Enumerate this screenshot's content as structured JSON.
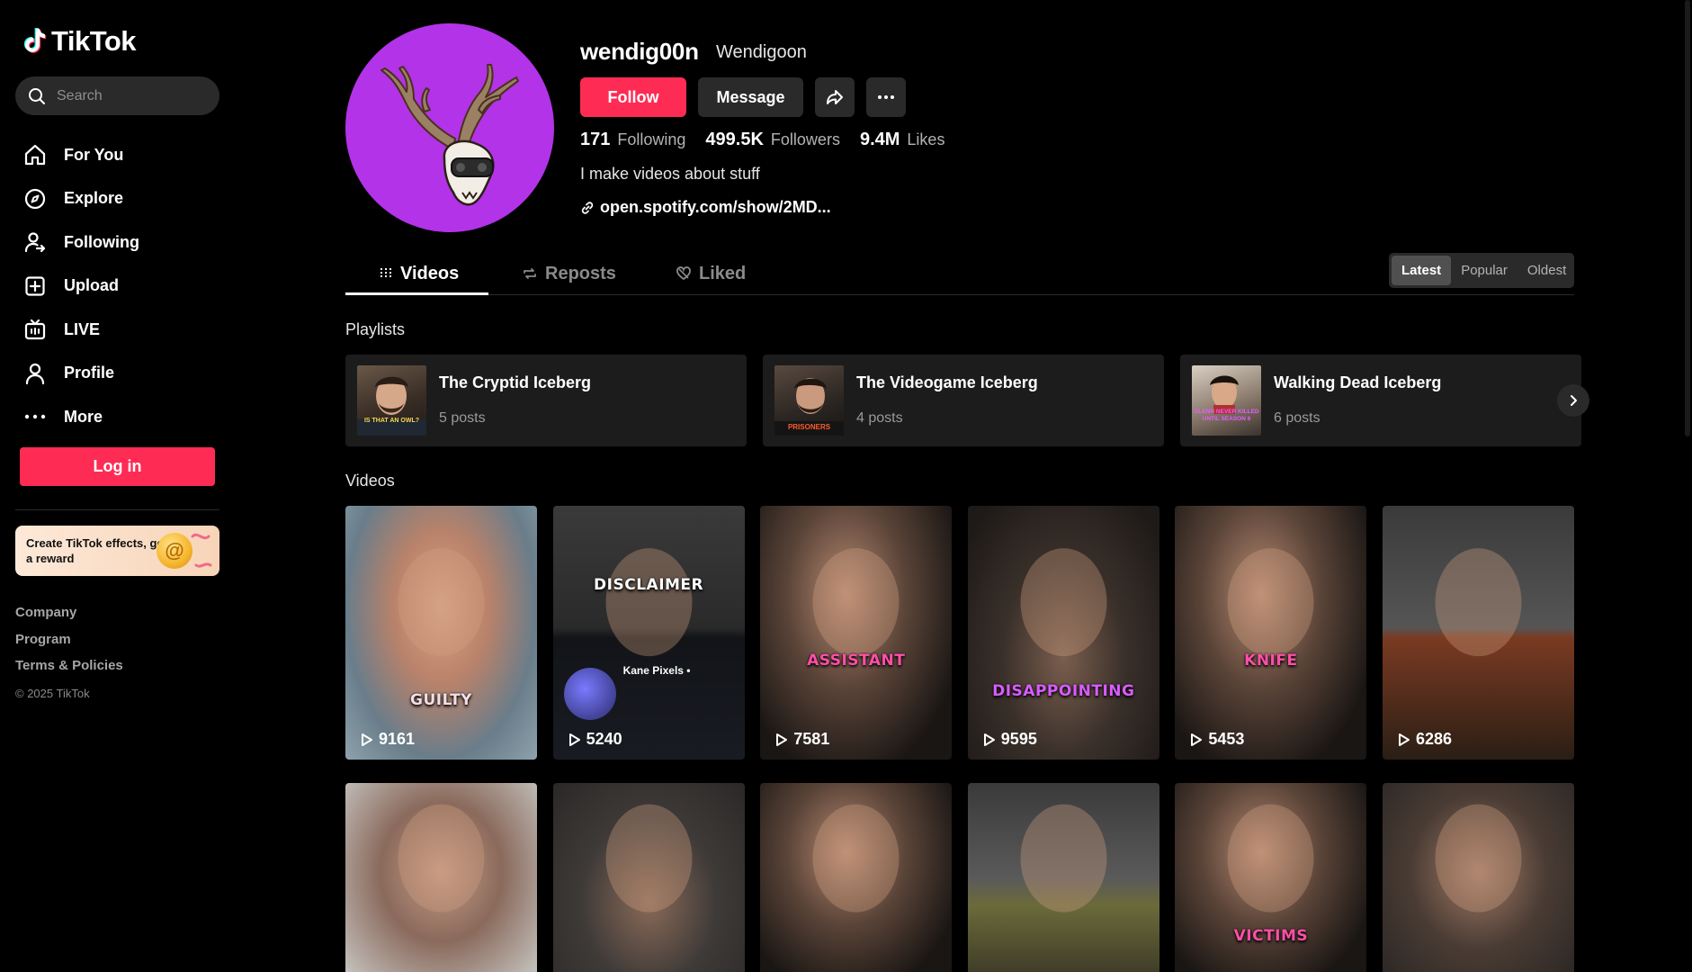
{
  "app": {
    "name": "TikTok"
  },
  "sidebar": {
    "search_placeholder": "Search",
    "nav": [
      {
        "label": "For You",
        "icon": "home-icon"
      },
      {
        "label": "Explore",
        "icon": "compass-icon"
      },
      {
        "label": "Following",
        "icon": "following-icon"
      },
      {
        "label": "Upload",
        "icon": "upload-icon"
      },
      {
        "label": "LIVE",
        "icon": "live-icon"
      },
      {
        "label": "Profile",
        "icon": "profile-icon"
      },
      {
        "label": "More",
        "icon": "more-icon"
      }
    ],
    "login_label": "Log in",
    "promo_text": "Create TikTok effects, get a reward",
    "footer": [
      "Company",
      "Program",
      "Terms & Policies"
    ],
    "copyright": "© 2025 TikTok"
  },
  "profile": {
    "username": "wendig00n",
    "nickname": "Wendigoon",
    "follow_label": "Follow",
    "message_label": "Message",
    "following_count": "171",
    "following_label": "Following",
    "followers_count": "499.5K",
    "followers_label": "Followers",
    "likes_count": "9.4M",
    "likes_label": "Likes",
    "bio": "I make videos about stuff",
    "link": "open.spotify.com/show/2MD..."
  },
  "tabs": [
    {
      "label": "Videos",
      "icon": "grid-icon",
      "active": true
    },
    {
      "label": "Reposts",
      "icon": "repost-icon",
      "active": false
    },
    {
      "label": "Liked",
      "icon": "heart-icon",
      "active": false
    }
  ],
  "sort": {
    "options": [
      "Latest",
      "Popular",
      "Oldest"
    ],
    "selected": "Latest"
  },
  "playlists_title": "Playlists",
  "playlists": [
    {
      "title": "The Cryptid Iceberg",
      "count": "5 posts",
      "thumb_caption": "IS THAT AN OWL?"
    },
    {
      "title": "The Videogame Iceberg",
      "count": "4 posts",
      "thumb_caption": "PRISONERS"
    },
    {
      "title": "Walking Dead Iceberg",
      "count": "6 posts",
      "thumb_caption": "GLENN NEVER KILLED UNTIL SEASON 6"
    }
  ],
  "videos_title": "Videos",
  "videos": [
    {
      "views": "9161",
      "caption": "GUILTY",
      "caption_color": "#f2dfe6"
    },
    {
      "views": "5240",
      "caption": "DISCLAIMER",
      "caption_color": "#ffffff",
      "overlay_name": "Kane Pixels •"
    },
    {
      "views": "7581",
      "caption": "ASSISTANT",
      "caption_color": "#ff4fa8"
    },
    {
      "views": "9595",
      "caption": "DISAPPOINTING",
      "caption_color": "#d85cff"
    },
    {
      "views": "5453",
      "caption": "KNIFE",
      "caption_color": "#ff4fa8"
    },
    {
      "views": "6286",
      "caption": "",
      "caption_color": "#ffffff"
    },
    {
      "views": "",
      "caption": "",
      "caption_color": "#ffffff"
    },
    {
      "views": "",
      "caption": "",
      "caption_color": "#ffffff"
    },
    {
      "views": "",
      "caption": "",
      "caption_color": "#ffffff"
    },
    {
      "views": "",
      "caption": "",
      "caption_color": "#ffffff"
    },
    {
      "views": "",
      "caption": "VICTIMS",
      "caption_color": "#ff4fa8"
    },
    {
      "views": "",
      "caption": "",
      "caption_color": "#ffffff"
    }
  ],
  "colors": {
    "accent": "#fe2c55",
    "avatar_bg": "#b333e8",
    "surface": "#1c1c1c",
    "button": "#2a2a2a"
  }
}
